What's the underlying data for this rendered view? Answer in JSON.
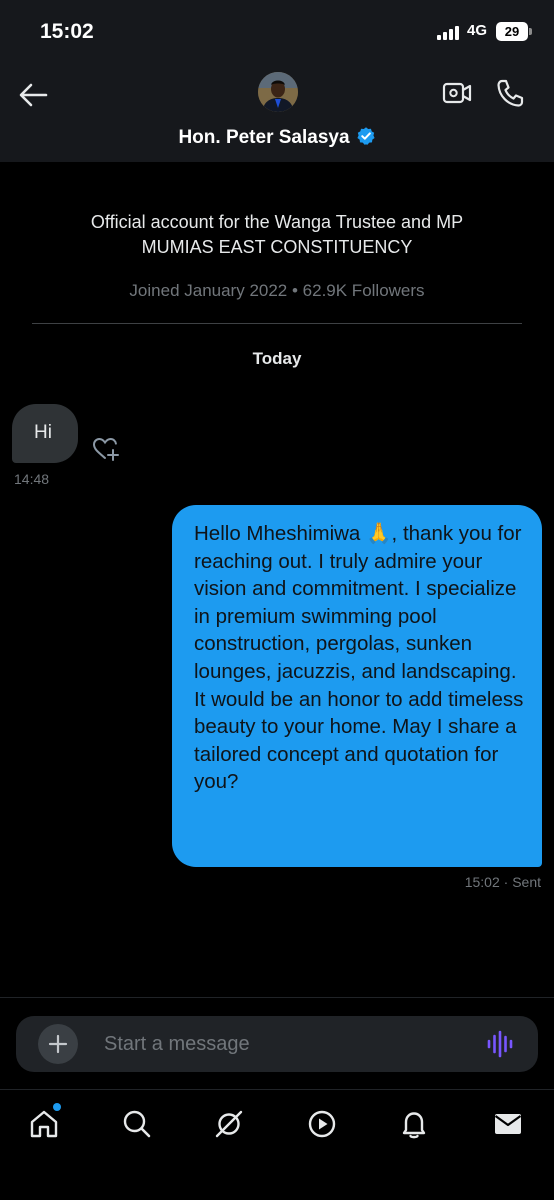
{
  "status_bar": {
    "time": "15:02",
    "network": "4G",
    "battery": "29"
  },
  "header": {
    "contact_name": "Hon. Peter Salasya",
    "verified": true
  },
  "profile": {
    "bio_line1": "Official account for the Wanga Trustee and MP",
    "bio_line2": "MUMIAS EAST CONSTITUENCY",
    "joined_followers": "Joined January 2022 • 62.9K Followers"
  },
  "conversation": {
    "day_label": "Today",
    "messages": [
      {
        "direction": "incoming",
        "text": "Hi",
        "time": "14:48"
      },
      {
        "direction": "outgoing",
        "text": "Hello Mheshimiwa 🙏, thank you for reaching out. I truly admire your vision and commitment. I specialize in premium swimming pool construction, pergolas, sunken lounges, jacuzzis, and landscaping. It would be an honor to add timeless beauty to your home. May I share a tailored concept and quotation for you?",
        "time": "15:02 · Sent"
      }
    ]
  },
  "composer": {
    "placeholder": "Start a message"
  },
  "colors": {
    "accent": "#1d9bf0",
    "background": "#000000",
    "incoming_bubble": "#2f3336",
    "voice_icon": "#7856ff"
  },
  "icons": {
    "back": "arrow-left-icon",
    "video_call": "video-camera-icon",
    "phone_call": "phone-icon",
    "react": "heart-plus-icon",
    "add": "plus-icon",
    "voice": "waveform-icon",
    "tabs": [
      "home-icon",
      "search-icon",
      "grok-icon",
      "video-icon",
      "bell-icon",
      "mail-icon"
    ]
  }
}
